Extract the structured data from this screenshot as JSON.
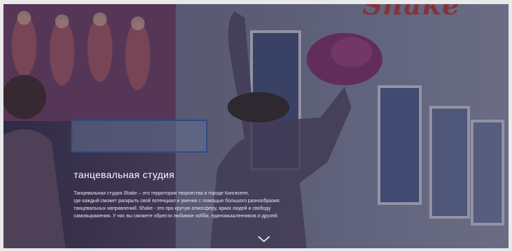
{
  "hero": {
    "background_logo": "Shake",
    "title": "танцевальная студия",
    "description": [
      "Танцевальная студия Shake – это территория творчества в городе Кингисепп,",
      "где каждый сможет раскрыть свой потенциал и умения с помощью большого разнообразия",
      "танцевальных направлений. Shake - это про крутую атмосферу, ярких людей и свободу",
      "самовыражения. У нас вы сможете обрести любимое хобби, единомышленников и друзей."
    ],
    "scroll_icon": "chevron-down-icon"
  }
}
